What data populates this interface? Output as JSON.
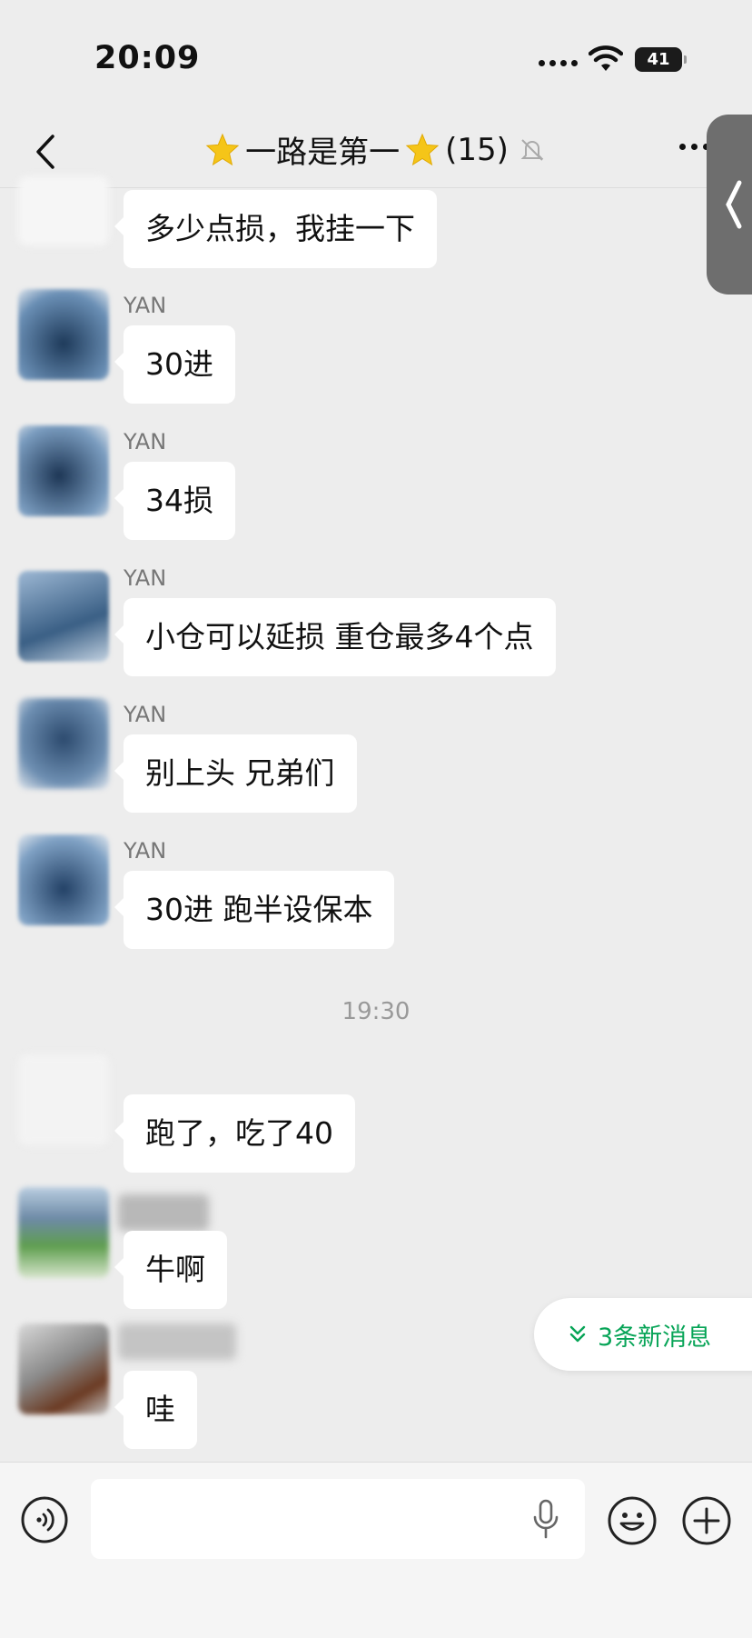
{
  "status_bar": {
    "time": "20:09",
    "battery": "41",
    "battery_level": 0.41
  },
  "nav": {
    "title": "一路是第一",
    "member_count": "(15)",
    "back_icon": "chevron-left-icon",
    "muted_icon": "bell-slash-icon",
    "more_icon": "ellipsis-icon"
  },
  "messages": [
    {
      "sender": "",
      "text": "多少点损，我挂一下"
    },
    {
      "sender": "YAN",
      "text": "30进"
    },
    {
      "sender": "YAN",
      "text": "34损"
    },
    {
      "sender": "YAN",
      "text": "小仓可以延损 重仓最多4个点"
    },
    {
      "sender": "YAN",
      "text": "别上头 兄弟们"
    },
    {
      "sender": "YAN",
      "text": "30进 跑半设保本"
    },
    {
      "sender": "",
      "text": "跑了，吃了40"
    },
    {
      "sender": "",
      "text": "牛啊"
    },
    {
      "sender": "",
      "text": "哇"
    }
  ],
  "timestamp": "19:30",
  "new_messages": {
    "label": "3条新消息",
    "icon": "double-chevron-down-icon"
  },
  "input_bar": {
    "voice_icon": "voice-icon",
    "mic_icon": "microphone-icon",
    "emoji_icon": "emoji-icon",
    "plus_icon": "plus-circle-icon"
  },
  "colors": {
    "background": "#ededed",
    "bubble": "#ffffff",
    "accent": "#07a457",
    "avatar_blue": "#3a5f85"
  }
}
